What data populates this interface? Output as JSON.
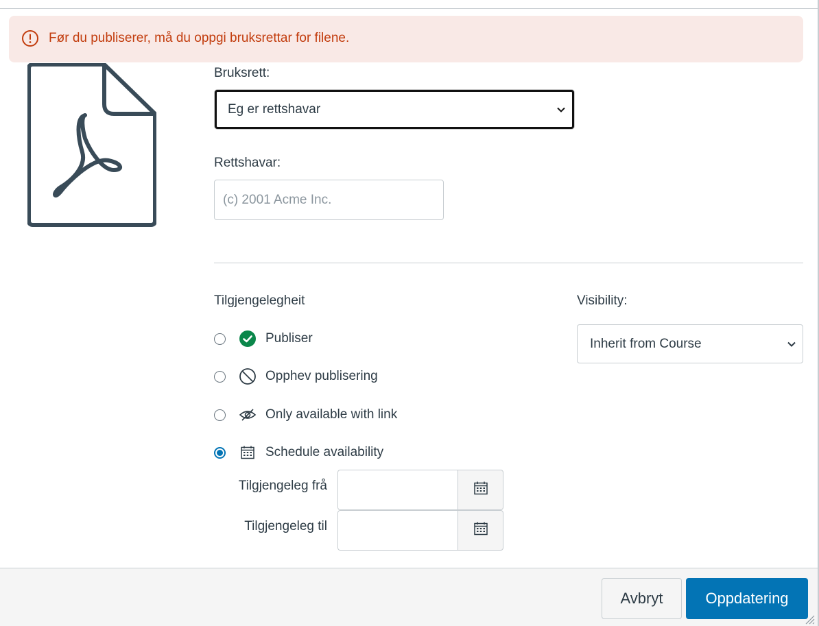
{
  "alert": {
    "text": "Før du publiserer, må du oppgi bruksrettar for filene.",
    "icon": "warning-icon",
    "color": "#c23c0d",
    "background": "#f9e9e6"
  },
  "file": {
    "icon": "pdf-file-icon"
  },
  "usage_rights": {
    "label": "Bruksrett:",
    "selected": "Eg er rettshavar"
  },
  "copyright_holder": {
    "label": "Rettshavar:",
    "placeholder": "(c) 2001 Acme Inc.",
    "value": ""
  },
  "availability": {
    "heading": "Tilgjengelegheit",
    "options": [
      {
        "label": "Publiser",
        "icon": "published-check-icon",
        "checked": false
      },
      {
        "label": "Opphev publisering",
        "icon": "unpublished-circle-slash-icon",
        "checked": false
      },
      {
        "label": "Only available with link",
        "icon": "eye-off-icon",
        "checked": false
      },
      {
        "label": "Schedule availability",
        "icon": "calendar-icon",
        "checked": true
      }
    ],
    "from_label": "Tilgjengeleg frå",
    "until_label": "Tilgjengeleg til",
    "from_value": "",
    "until_value": ""
  },
  "visibility": {
    "label": "Visibility:",
    "selected": "Inherit from Course"
  },
  "footer": {
    "cancel_label": "Avbryt",
    "update_label": "Oppdatering"
  },
  "colors": {
    "primary": "#0374b5",
    "success": "#0b874b",
    "text": "#2d3b45",
    "border": "#c7cdd1"
  }
}
